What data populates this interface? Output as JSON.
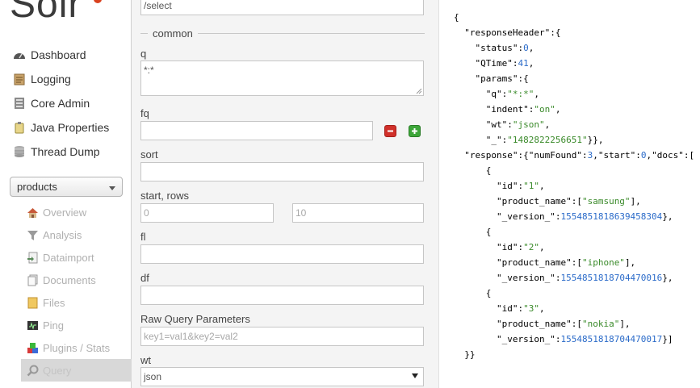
{
  "app": {
    "logo_text": "Solr"
  },
  "sidebar": {
    "nav": [
      {
        "label": "Dashboard",
        "icon": "dashboard-icon"
      },
      {
        "label": "Logging",
        "icon": "logging-icon"
      },
      {
        "label": "Core Admin",
        "icon": "core-admin-icon"
      },
      {
        "label": "Java Properties",
        "icon": "java-properties-icon"
      },
      {
        "label": "Thread Dump",
        "icon": "thread-dump-icon"
      }
    ],
    "core_selector": {
      "selected": "products"
    },
    "core_menu": [
      {
        "label": "Overview",
        "icon": "home-icon"
      },
      {
        "label": "Analysis",
        "icon": "funnel-icon"
      },
      {
        "label": "Dataimport",
        "icon": "dataimport-icon"
      },
      {
        "label": "Documents",
        "icon": "documents-icon"
      },
      {
        "label": "Files",
        "icon": "folder-icon"
      },
      {
        "label": "Ping",
        "icon": "ping-icon"
      },
      {
        "label": "Plugins / Stats",
        "icon": "plugins-icon"
      },
      {
        "label": "Query",
        "icon": "magnifier-icon"
      }
    ]
  },
  "form": {
    "request_handler": "/select",
    "common_legend": "common",
    "q_label": "q",
    "q_value": "*:*",
    "fq_label": "fq",
    "sort_label": "sort",
    "start_rows_label": "start, rows",
    "start_placeholder": "0",
    "rows_placeholder": "10",
    "fl_label": "fl",
    "df_label": "df",
    "raw_label": "Raw Query Parameters",
    "raw_placeholder": "key1=val1&key2=val2",
    "wt_label": "wt",
    "wt_value": "json"
  },
  "response": {
    "lines": [
      "{",
      "  \"responseHeader\":{",
      "    \"status\":0,",
      "    \"QTime\":41,",
      "    \"params\":{",
      "      \"q\":\"*:*\",",
      "      \"indent\":\"on\",",
      "      \"wt\":\"json\",",
      "      \"_\":\"1482822256651\"}},",
      "  \"response\":{\"numFound\":3,\"start\":0,\"docs\":[",
      "      {",
      "        \"id\":\"1\",",
      "        \"product_name\":[\"samsung\"],",
      "        \"_version_\":1554851818639458304},",
      "      {",
      "        \"id\":\"2\",",
      "        \"product_name\":[\"iphone\"],",
      "        \"_version_\":1554851818704470016},",
      "      {",
      "        \"id\":\"3\",",
      "        \"product_name\":[\"nokia\"],",
      "        \"_version_\":1554851818704470017}]",
      "  }}"
    ]
  },
  "colors": {
    "brand": "#d9411e",
    "json_string": "#3a8a2a",
    "json_number": "#2b6bc9"
  }
}
